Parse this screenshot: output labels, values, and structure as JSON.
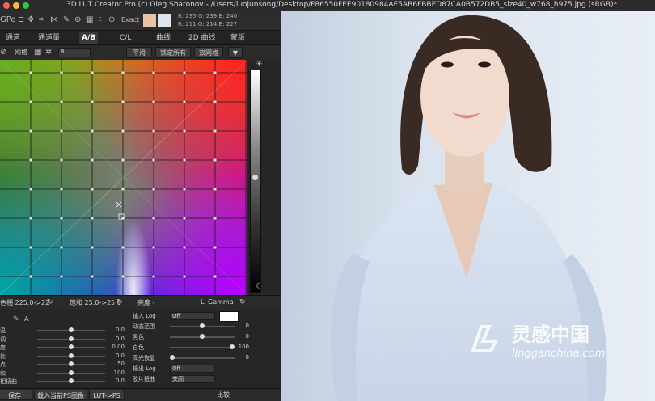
{
  "window": {
    "title": "3D LUT Creator Pro (c) Oleg Sharonov - /Users/luojunsong/Desktop/F86550FEE90180984AE5AB6FBBED87CA0B572DB5_size40_w768_h975.jpg (sRGB)*",
    "traffic_colors": [
      "#fe5f57",
      "#febc2e",
      "#28c840"
    ]
  },
  "toolbar": {
    "gpu_label": "GPe",
    "exact_label": "Exact",
    "swatch_a": "#e8c4a4",
    "swatch_b": "#dfe6f0",
    "rgb_top": "R: 235  G: 239  B: 240",
    "rgb_bottom": "R: 211  G: 214  B: 227"
  },
  "tabs": [
    "通道",
    "通道量",
    "A/B",
    "C/L",
    "曲线",
    "2D 曲线",
    "蒙版"
  ],
  "subbar": {
    "grid_label": "网格",
    "grid_value": "8",
    "smooth": "平滑",
    "lock_all": "锁定所有",
    "double_grid": "双网格"
  },
  "lower": {
    "hue": "色相 225.0->22",
    "sat": "饱和 25.0->25.0",
    "luma": "亮度 -",
    "gamma_prefix": "L",
    "gamma": "Gamma"
  },
  "left_params": [
    {
      "label": "温",
      "value": "0.0",
      "knob": 0.5
    },
    {
      "label": "调",
      "value": "0.0",
      "knob": 0.5
    },
    {
      "label": "度",
      "value": "0.00",
      "knob": 0.5
    },
    {
      "label": "比",
      "value": "0.0",
      "knob": 0.5
    },
    {
      "label": "点",
      "value": "50",
      "knob": 0.5
    },
    {
      "label": "和",
      "value": "100",
      "knob": 0.5
    },
    {
      "label": "相扭曲",
      "value": "0.0",
      "knob": 0.5
    }
  ],
  "right_params": [
    {
      "label": "输入 Log",
      "dd": "Off"
    },
    {
      "label": "动态范围",
      "value": "0",
      "knob": 0.5
    },
    {
      "label": "黑色",
      "value": "0",
      "knob": 0.5
    },
    {
      "label": "白色",
      "value": "100",
      "knob": 1.0
    },
    {
      "label": "高光恢复",
      "value": "0",
      "knob": 0.0
    },
    {
      "label": "输出 Log",
      "dd": "Off"
    },
    {
      "label": "胶片扭曲",
      "dd": "关闭"
    }
  ],
  "bottom": {
    "save": "保存 3DLUT",
    "load_ps": "载入当前PS图像",
    "lut_ps": "LUT->PS",
    "compare": "比较"
  },
  "watermark": {
    "brand": "灵感中国",
    "site": "lingganchina.com"
  }
}
